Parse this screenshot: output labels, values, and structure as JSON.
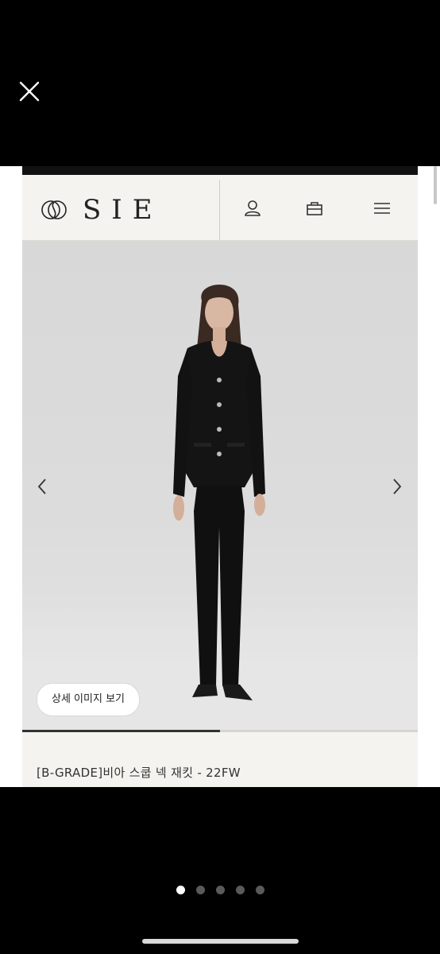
{
  "viewer": {
    "close_icon": "close-icon",
    "page_indicator": {
      "count": 5,
      "active_index": 0
    }
  },
  "site": {
    "logo_text": "SIE",
    "logo_mark_icon": "sie-monogram-icon",
    "header_icons": [
      "user-icon",
      "shopping-bag-icon",
      "menu-icon"
    ]
  },
  "product": {
    "detail_button_label": "상세 이미지 보기",
    "title": "[B-GRADE]비아 스쿱 넥 재킷 - 22FW",
    "image_progress": 0.5,
    "arrows": [
      "chevron-left-icon",
      "chevron-right-icon"
    ]
  },
  "colors": {
    "background": "#000000",
    "page_bg": "#f4f3ef",
    "accent": "#333333"
  }
}
